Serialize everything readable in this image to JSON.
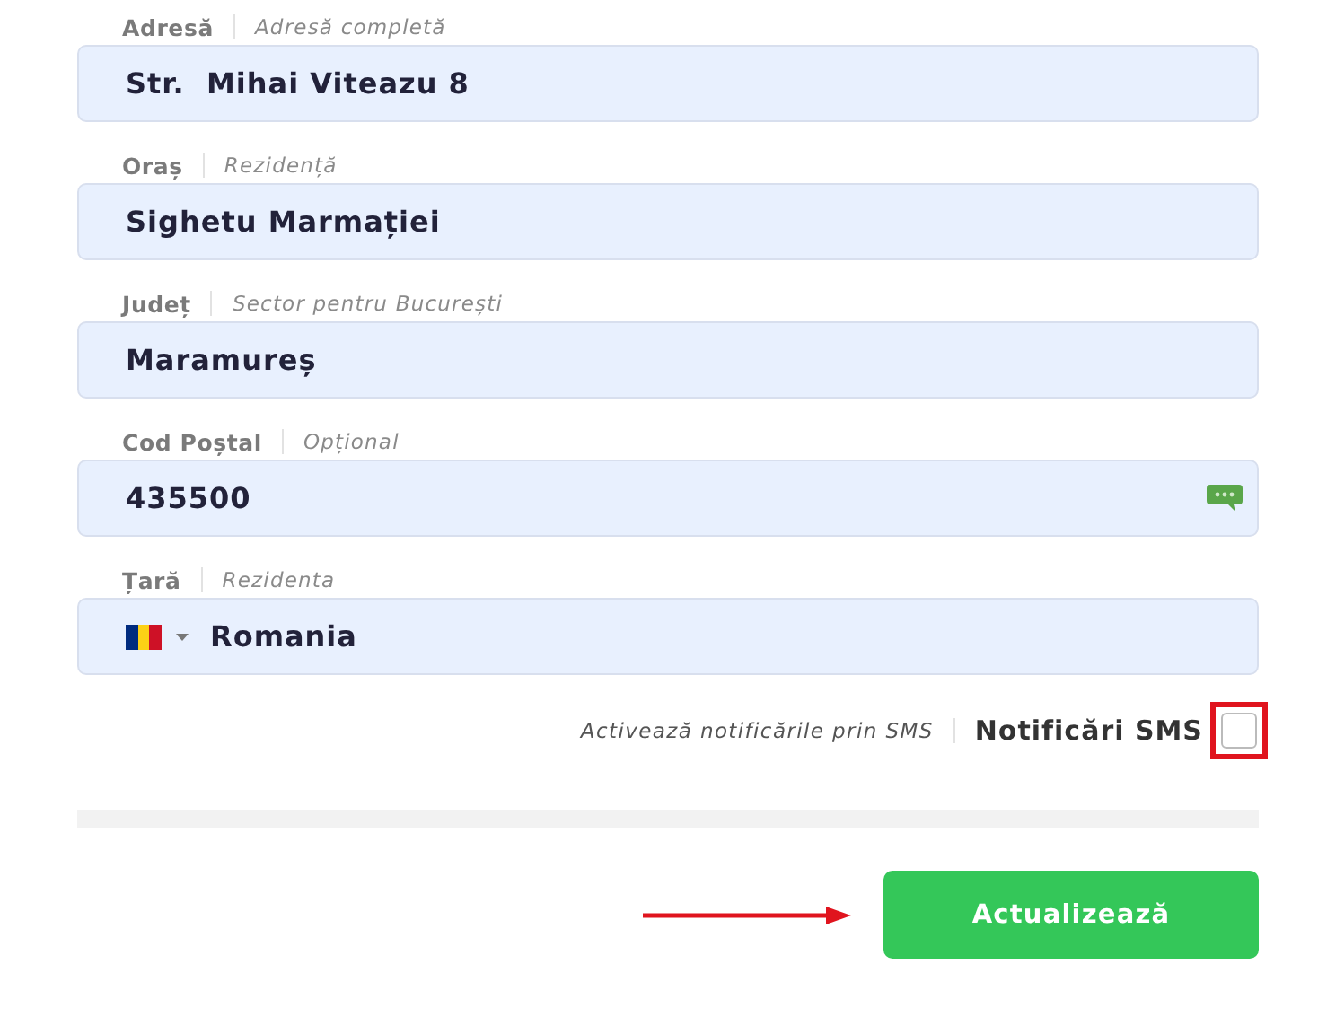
{
  "fields": [
    {
      "label": "Adresă",
      "hint": "Adresă completă",
      "value": "Str.  Mihai Viteazu 8",
      "kind": "text"
    },
    {
      "label": "Oraș",
      "hint": "Rezidență",
      "value": "Sighetu Marmației",
      "kind": "text"
    },
    {
      "label": "Județ",
      "hint": "Sector pentru București",
      "value": "Maramureș",
      "kind": "text"
    },
    {
      "label": "Cod Poștal",
      "hint": "Opțional",
      "value": "435500",
      "kind": "postal"
    },
    {
      "label": "Țară",
      "hint": "Rezidenta",
      "value": "Romania",
      "kind": "country"
    }
  ],
  "sms": {
    "hint": "Activează notificările prin SMS",
    "label": "Notificări SMS",
    "checked": false,
    "highlighted": true
  },
  "submit": {
    "label": "Actualizează",
    "callout_arrow": true
  }
}
